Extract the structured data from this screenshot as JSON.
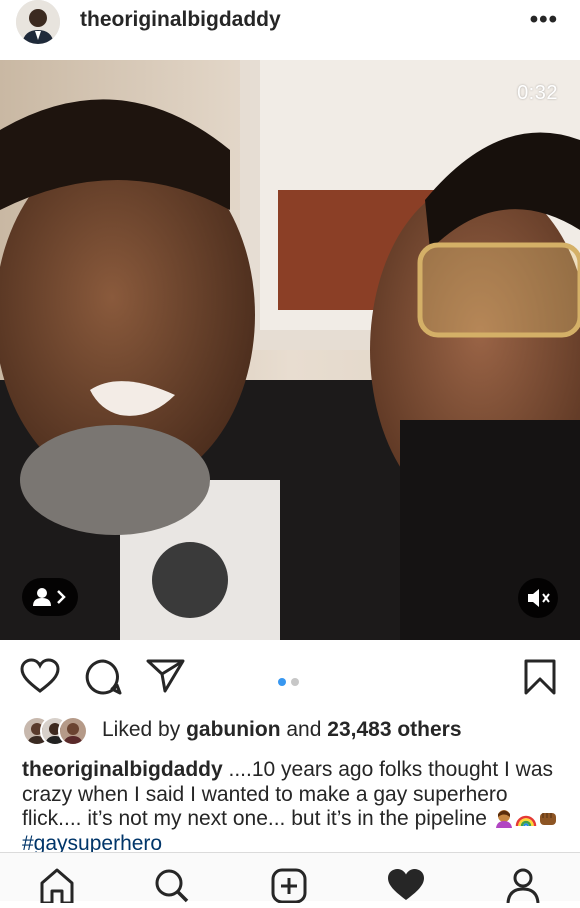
{
  "post": {
    "username": "theoriginalbigdaddy",
    "more_label": "•••",
    "video_timer": "0:32"
  },
  "actions": {
    "like_icon": "heart-outline-icon",
    "comment_icon": "comment-icon",
    "share_icon": "paper-plane-icon",
    "save_icon": "bookmark-icon",
    "carousel": {
      "count": 2,
      "active": 0
    }
  },
  "likes": {
    "prefix": "Liked by ",
    "user": "gabunion",
    "middle": " and ",
    "count": "23,483 others"
  },
  "caption": {
    "username": "theoriginalbigdaddy",
    "text": " ....10 years ago folks thought I was crazy when I said I wanted to make a gay superhero flick.... it’s not my next one... but it’s in the pipeline ",
    "emojis": [
      "woman-superhero-emoji",
      "rainbow-emoji",
      "fist-emoji"
    ],
    "hashtag": "#gaysuperhero"
  },
  "nav": {
    "items": [
      "home-icon",
      "search-icon",
      "new-post-icon",
      "activity-heart-icon",
      "profile-icon"
    ]
  },
  "colors": {
    "text": "#262626",
    "hashtag": "#003569",
    "dot_active": "#3897f0",
    "dot_inactive": "#c7c7c7"
  }
}
